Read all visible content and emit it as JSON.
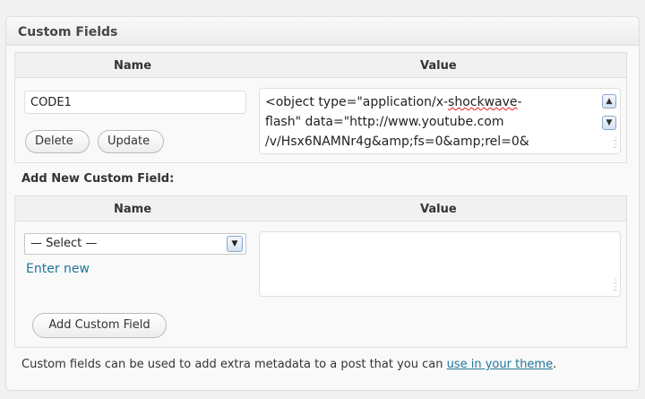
{
  "postbox": {
    "title": "Custom Fields"
  },
  "existing_fields": {
    "headers": {
      "name": "Name",
      "value": "Value"
    },
    "row": {
      "name": "CODE1",
      "value_lines": [
        "<object type=\"application/x-",
        "shockwave",
        "-",
        "flash\" data=\"http://www.youtube.com",
        "/v/Hsx6NAMNr4g&amp;fs=0&amp;rel=0&"
      ],
      "delete_label": "Delete",
      "update_label": "Update"
    }
  },
  "add_new": {
    "section_label": "Add New Custom Field:",
    "headers": {
      "name": "Name",
      "value": "Value"
    },
    "select_value": "— Select —",
    "enter_new_label": "Enter new",
    "new_value": "",
    "add_button_label": "Add Custom Field"
  },
  "footer": {
    "text": "Custom fields can be used to add extra metadata to a post that you can ",
    "link": "use in your theme",
    "end": "."
  },
  "colors": {
    "link": "#21759b",
    "border": "#dfdfdf",
    "background": "#f9f9f9"
  }
}
